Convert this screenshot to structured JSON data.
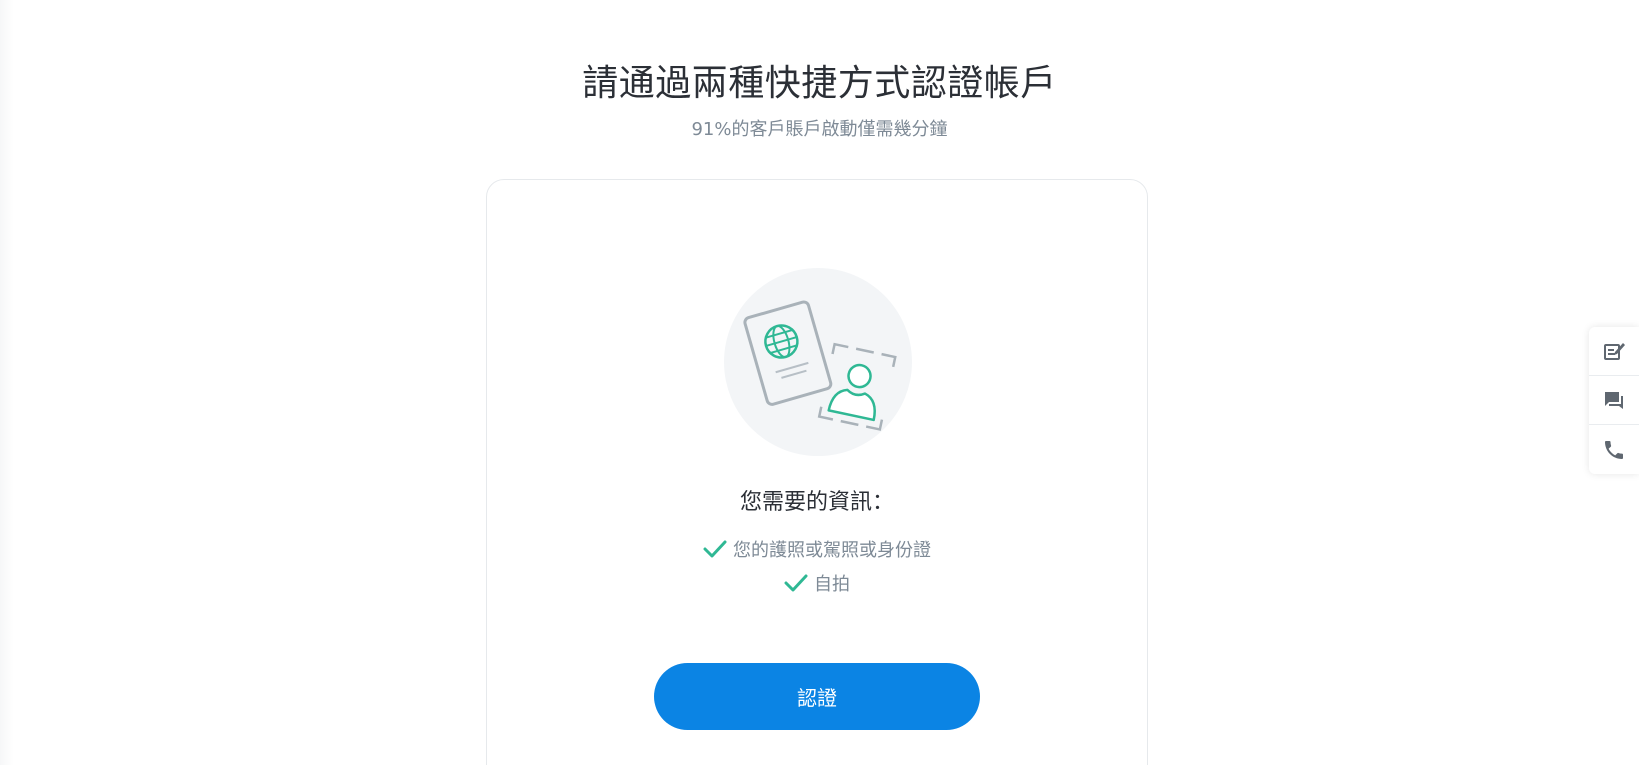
{
  "header": {
    "title": "請通過兩種快捷方式認證帳戶",
    "subtitle": "91%的客戶賬戶啟動僅需幾分鐘"
  },
  "card": {
    "illustration_icon": "passport-selfie-illustration",
    "info_title": "您需要的資訊：",
    "requirements": [
      {
        "icon": "check-icon",
        "label": "您的護照或駕照或身份證"
      },
      {
        "icon": "check-icon",
        "label": "自拍"
      }
    ],
    "verify_button_label": "認證"
  },
  "side_toolbar": {
    "items": [
      {
        "icon": "feedback-edit-icon"
      },
      {
        "icon": "chat-icon"
      },
      {
        "icon": "phone-icon"
      }
    ]
  },
  "colors": {
    "accent": "#0b84e4",
    "check": "#2fb894",
    "text_primary": "#2b2f36",
    "text_secondary": "#7e8a96"
  }
}
